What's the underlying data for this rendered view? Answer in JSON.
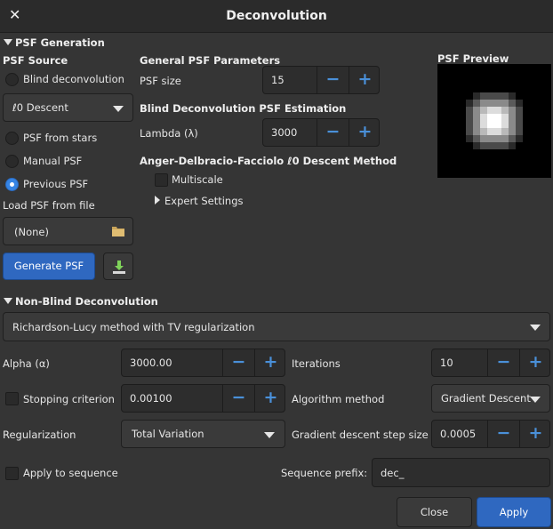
{
  "window": {
    "title": "Deconvolution"
  },
  "psf_generation": {
    "header": "PSF Generation",
    "source": {
      "heading": "PSF Source",
      "blind": "Blind deconvolution",
      "l0_combo": "ℓ0 Descent",
      "from_stars": "PSF from stars",
      "manual": "Manual PSF",
      "previous": "Previous PSF",
      "selected": "previous"
    },
    "load_file": {
      "label": "Load PSF from file",
      "value": "(None)"
    },
    "generate_label": "Generate PSF",
    "general": {
      "heading": "General PSF Parameters",
      "psf_size_label": "PSF size",
      "psf_size": "15"
    },
    "blind_estimation": {
      "heading": "Blind Deconvolution PSF Estimation",
      "lambda_label": "Lambda (λ)",
      "lambda": "3000"
    },
    "method": {
      "heading": "Anger-Delbracio-Facciolo ℓ0 Descent Method",
      "multiscale": "Multiscale",
      "expert": "Expert Settings"
    },
    "preview": {
      "heading": "PSF Preview"
    }
  },
  "non_blind": {
    "header": "Non-Blind Deconvolution",
    "method_combo": "Richardson-Lucy method with TV regularization",
    "alpha_label": "Alpha (α)",
    "alpha": "3000.00",
    "iterations_label": "Iterations",
    "iterations": "10",
    "stopping_label": "Stopping criterion",
    "stopping": "0.00100",
    "algorithm_label": "Algorithm method",
    "algorithm": "Gradient Descent",
    "regularization_label": "Regularization",
    "regularization": "Total Variation",
    "step_label": "Gradient descent step size",
    "step": "0.0005"
  },
  "sequence": {
    "apply_label": "Apply to sequence",
    "prefix_label": "Sequence prefix:",
    "prefix": "dec_"
  },
  "footer": {
    "close": "Close",
    "apply": "Apply"
  },
  "icons": {
    "minus": "−",
    "plus": "+",
    "close": "✕",
    "folder": "folder-icon",
    "download": "download-icon"
  },
  "colors": {
    "accent": "#3584e4",
    "primary_button": "#2f68c0",
    "spin_icon": "#4a90d9"
  }
}
